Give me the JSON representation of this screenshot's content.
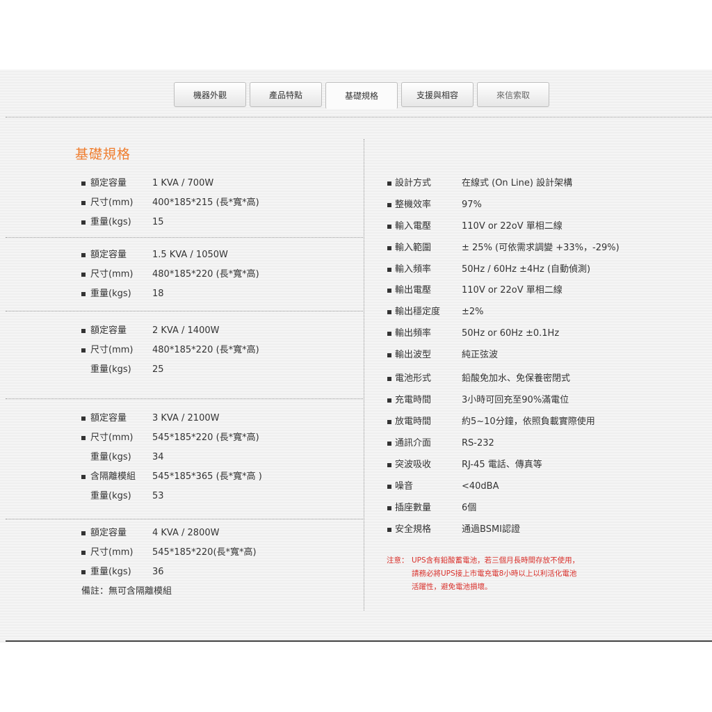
{
  "tabs": [
    {
      "label": "機器外觀"
    },
    {
      "label": "產品特點"
    },
    {
      "label": "基礎規格"
    },
    {
      "label": "支援與相容"
    },
    {
      "label": "來信索取"
    }
  ],
  "section_title": "基礎規格",
  "models": [
    {
      "rows": [
        {
          "bullet": true,
          "label": "額定容量",
          "value": "1 KVA / 700W"
        },
        {
          "bullet": true,
          "label": "尺寸(mm)",
          "value": "400*185*215 (長*寬*高)"
        },
        {
          "bullet": true,
          "label": "重量(kgs)",
          "value": "15"
        }
      ]
    },
    {
      "rows": [
        {
          "bullet": true,
          "label": "額定容量",
          "value": "1.5 KVA / 1050W"
        },
        {
          "bullet": true,
          "label": "尺寸(mm)",
          "value": "480*185*220 (長*寬*高)"
        },
        {
          "bullet": true,
          "label": "重量(kgs)",
          "value": "18"
        }
      ]
    },
    {
      "rows": [
        {
          "bullet": true,
          "label": "額定容量",
          "value": "2 KVA / 1400W"
        },
        {
          "bullet": true,
          "label": "尺寸(mm)",
          "value": "480*185*220 (長*寬*高)"
        },
        {
          "bullet": false,
          "label": "重量(kgs)",
          "value": "25"
        }
      ]
    },
    {
      "rows": [
        {
          "bullet": true,
          "label": "額定容量",
          "value": "3 KVA / 2100W"
        },
        {
          "bullet": true,
          "label": "尺寸(mm)",
          "value": "545*185*220 (長*寬*高)"
        },
        {
          "bullet": false,
          "label": "重量(kgs)",
          "value": "34"
        },
        {
          "bullet": true,
          "label": "含隔離模組",
          "value": "545*185*365 (長*寬*高 )"
        },
        {
          "bullet": false,
          "label": "重量(kgs)",
          "value": "53"
        }
      ]
    },
    {
      "rows": [
        {
          "bullet": true,
          "label": "額定容量",
          "value": "4 KVA / 2800W"
        },
        {
          "bullet": true,
          "label": "尺寸(mm)",
          "value": "545*185*220(長*寬*高)"
        },
        {
          "bullet": true,
          "label": "重量(kgs)",
          "value": "36"
        }
      ]
    }
  ],
  "remark": "備註：無可含隔離模組",
  "specs": [
    {
      "label": "設計方式",
      "value": "在線式 (On Line) 設計架構"
    },
    {
      "label": "整機效率",
      "value": "97%"
    },
    {
      "label": "輸入電壓",
      "value": "110V or 22oV 單相二線"
    },
    {
      "label": "輸入範圍",
      "value": "± 25% (可依需求調變 +33%，-29%)"
    },
    {
      "label": "輸入頻率",
      "value": "50Hz / 60Hz  ±4Hz (自動偵測)"
    },
    {
      "label": "輸出電壓",
      "value": "110V or 22oV 單相二線"
    },
    {
      "label": "輸出穩定度",
      "value": "±2%"
    },
    {
      "label": "輸出頻率",
      "value": "50Hz or 60Hz  ±0.1Hz"
    },
    {
      "label": "輸出波型",
      "value": "純正弦波"
    },
    {
      "label": "電池形式",
      "value": "鉛酸免加水、免保養密閉式"
    },
    {
      "label": "充電時間",
      "value": "3小時可回充至90%滿電位"
    },
    {
      "label": "放電時間",
      "value": "約5~10分鐘，依照負載實際使用"
    },
    {
      "label": "通訊介面",
      "value": "RS-232"
    },
    {
      "label": "突波吸收",
      "value": "RJ-45 電話、傳真等"
    },
    {
      "label": "噪音",
      "value": "<40dBA"
    },
    {
      "label": "插座數量",
      "value": "6個"
    },
    {
      "label": "安全規格",
      "value": "通過BSMI認證"
    }
  ],
  "note": {
    "prefix": "注意：",
    "lines": [
      "UPS含有鉛酸蓄電池，若三個月長時間存放不使用，",
      "請務必將UPS接上市電充電8小時以上以利活化電池",
      "活躍性，避免電池損壞。"
    ]
  },
  "colors": {
    "accent": "#ef7d2e",
    "note": "#d9302b"
  }
}
